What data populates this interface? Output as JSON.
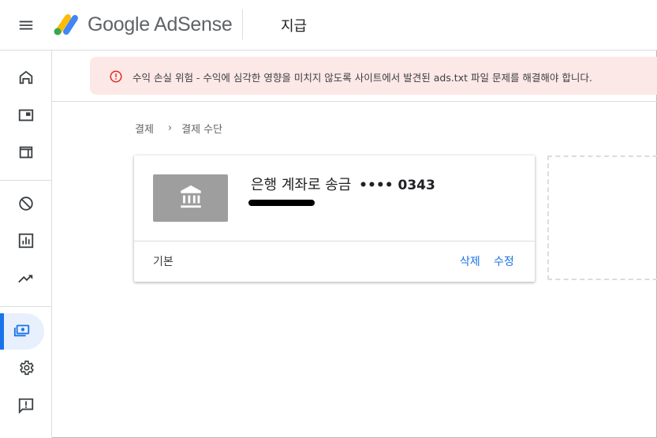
{
  "header": {
    "brand": "Google AdSense",
    "title": "지급"
  },
  "alert": {
    "text": "수익 손실 위험 - 수익에 심각한 영향을 미치지 않도록 사이트에서 발견된 ads.txt 파일 문제를 해결해야 합니다.",
    "color": "#fce8e6",
    "icon": "error-icon"
  },
  "breadcrumb": {
    "items": [
      "결제",
      "결제 수단"
    ]
  },
  "payment_method": {
    "name": "은행 계좌로 송금",
    "masked_account": "•••• 0343",
    "status": "기본",
    "delete_label": "삭제",
    "edit_label": "수정",
    "icon": "bank-icon"
  },
  "sidebar": {
    "items": [
      {
        "icon": "home-icon"
      },
      {
        "icon": "sites-icon"
      },
      {
        "icon": "ads-icon"
      },
      {
        "icon": "blocking-controls-icon"
      },
      {
        "icon": "reports-icon"
      },
      {
        "icon": "optimization-icon"
      },
      {
        "icon": "payments-icon",
        "active": true
      },
      {
        "icon": "settings-icon"
      },
      {
        "icon": "feedback-icon"
      }
    ]
  },
  "colors": {
    "accent": "#1a73e8",
    "active_bg": "#e8f0fe"
  }
}
